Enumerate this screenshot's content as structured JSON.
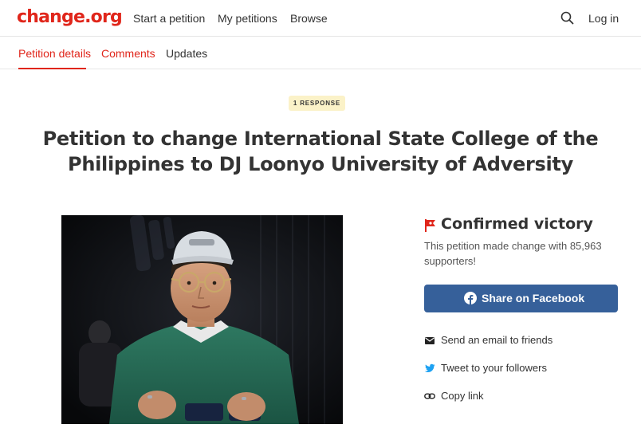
{
  "header": {
    "logo": "change.org",
    "nav": {
      "start": "Start a petition",
      "mine": "My petitions",
      "browse": "Browse",
      "login": "Log in"
    },
    "icons": {
      "search": "search-icon"
    }
  },
  "tabs": {
    "details": "Petition details",
    "comments": "Comments",
    "updates": "Updates",
    "active": "Petition details"
  },
  "petition": {
    "badge": "1 RESPONSE",
    "title": "Petition to change International State College of the Philippines to DJ Loonyo University of Adversity"
  },
  "victory": {
    "title": "Confirmed victory",
    "description": "This petition made change with 85,963 supporters!",
    "icon": "victory-flag-icon"
  },
  "share": {
    "facebook": "Share on Facebook",
    "email": "Send an email to friends",
    "twitter": "Tweet to your followers",
    "copy": "Copy link"
  },
  "colors": {
    "brand": "#e0261b",
    "facebook": "#36609a",
    "twitter": "#1da1f2",
    "badge_bg": "#fbf2c8"
  }
}
